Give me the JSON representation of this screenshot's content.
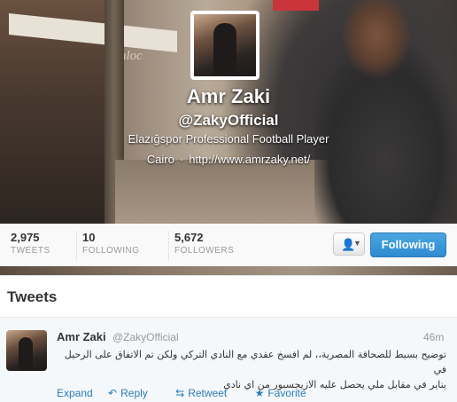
{
  "profile": {
    "name": "Amr Zaki",
    "handle": "@ZakyOfficial",
    "bio": "Elazığspor Professional Football Player",
    "location": "Cairo",
    "separator": "·",
    "url": "http://www.amrzaky.net/",
    "background_sign": "Sanloc"
  },
  "stats": [
    {
      "value": "2,975",
      "label": "TWEETS"
    },
    {
      "value": "10",
      "label": "FOLLOWING"
    },
    {
      "value": "5,672",
      "label": "FOLLOWERS"
    }
  ],
  "actions": {
    "user_menu_icon": "user-icon",
    "follow_label": "Following"
  },
  "tweets_section": {
    "title": "Tweets",
    "tweet": {
      "name": "Amr Zaki",
      "handle": "@ZakyOfficial",
      "time": "46m",
      "text_line1": "توضيح بسيط للصحافة المصرية،، لم افسخ عقدي مع النادي التركي ولكن تم الاتفاق على الرحيل في",
      "text_line2": "يناير في مقابل ملي يحصل عليه الازيجسبور من اي نادي",
      "expand": "Expand",
      "reply": "Reply",
      "retweet": "Retweet",
      "favorite": "Favorite"
    }
  },
  "colors": {
    "accent": "#2b7bb9",
    "follow_button": "#3a9ad9"
  }
}
